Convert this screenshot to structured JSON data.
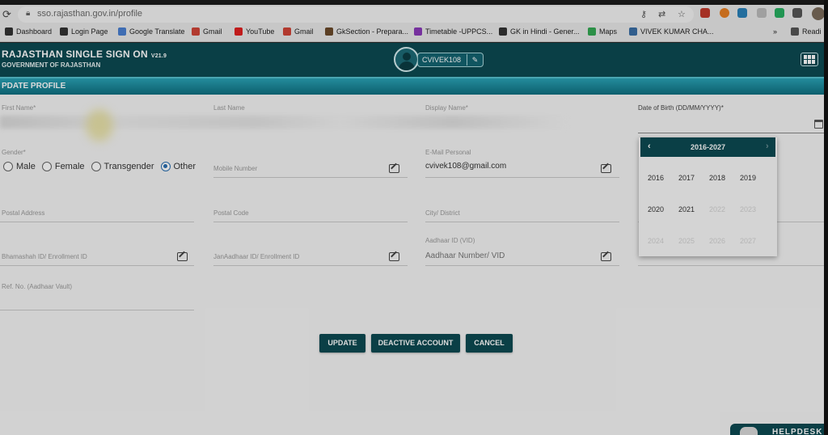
{
  "browser": {
    "url": "sso.rajasthan.gov.in/profile",
    "bookmarks": [
      {
        "label": "Dashboard",
        "color": "#333333"
      },
      {
        "label": "Login Page",
        "color": "#333333"
      },
      {
        "label": "Google Translate",
        "color": "#4a7fd1"
      },
      {
        "label": "Gmail",
        "color": "#d04437"
      },
      {
        "label": "YouTube",
        "color": "#e02020"
      },
      {
        "label": "Gmail",
        "color": "#d04437"
      },
      {
        "label": "GkSection - Prepara...",
        "color": "#6a4a2a"
      },
      {
        "label": "Timetable -UPPCS...",
        "color": "#8a3ab9"
      },
      {
        "label": "GK in Hindi - Gener...",
        "color": "#333333"
      },
      {
        "label": "Maps",
        "color": "#34a853"
      },
      {
        "label": "VIVEK KUMAR CHA...",
        "color": "#3a6ea5"
      }
    ],
    "more_label": "»",
    "reading_list_label": "Readi"
  },
  "header": {
    "title": "RAJASTHAN SINGLE SIGN ON",
    "version": "V21.9",
    "subtitle": "GOVERNMENT OF RAJASTHAN",
    "username": "CVIVEK108"
  },
  "section": {
    "title": "PDATE PROFILE"
  },
  "form": {
    "first_name_label": "First Name*",
    "last_name_label": "Last Name",
    "display_name_label": "Display Name*",
    "dob_label": "Date of Birth (DD/MM/YYYY)*",
    "gender_label": "Gender*",
    "gender_options": [
      "Male",
      "Female",
      "Transgender",
      "Other"
    ],
    "gender_selected": "Other",
    "mobile_placeholder": "Mobile Number",
    "email_label": "E-Mail Personal",
    "email_value": "cvivek108@gmail.com",
    "postal_address_placeholder": "Postal Address",
    "postal_code_placeholder": "Postal Code",
    "city_placeholder": "City/ District",
    "bhamashah_placeholder": "Bhamashah ID/ Enrollment ID",
    "janaadhaar_placeholder": "JanAadhaar ID/ Enrollment ID",
    "aadhaar_label": "Aadhaar ID (VID)",
    "aadhaar_placeholder": "Aadhaar Number/ VID",
    "ref_placeholder": "Ref. No. (Aadhaar Vault)"
  },
  "datepicker": {
    "range": "2016-2027",
    "prev": "‹",
    "next": "›",
    "years": [
      {
        "year": "2016",
        "enabled": true
      },
      {
        "year": "2017",
        "enabled": true
      },
      {
        "year": "2018",
        "enabled": true
      },
      {
        "year": "2019",
        "enabled": true
      },
      {
        "year": "2020",
        "enabled": true
      },
      {
        "year": "2021",
        "enabled": true
      },
      {
        "year": "2022",
        "enabled": false
      },
      {
        "year": "2023",
        "enabled": false
      },
      {
        "year": "2024",
        "enabled": false
      },
      {
        "year": "2025",
        "enabled": false
      },
      {
        "year": "2026",
        "enabled": false
      },
      {
        "year": "2027",
        "enabled": false
      }
    ]
  },
  "buttons": {
    "update": "UPDATE",
    "deactivate": "DEACTIVE ACCOUNT",
    "cancel": "CANCEL"
  },
  "helpdesk": {
    "label": "HELPDESK"
  }
}
